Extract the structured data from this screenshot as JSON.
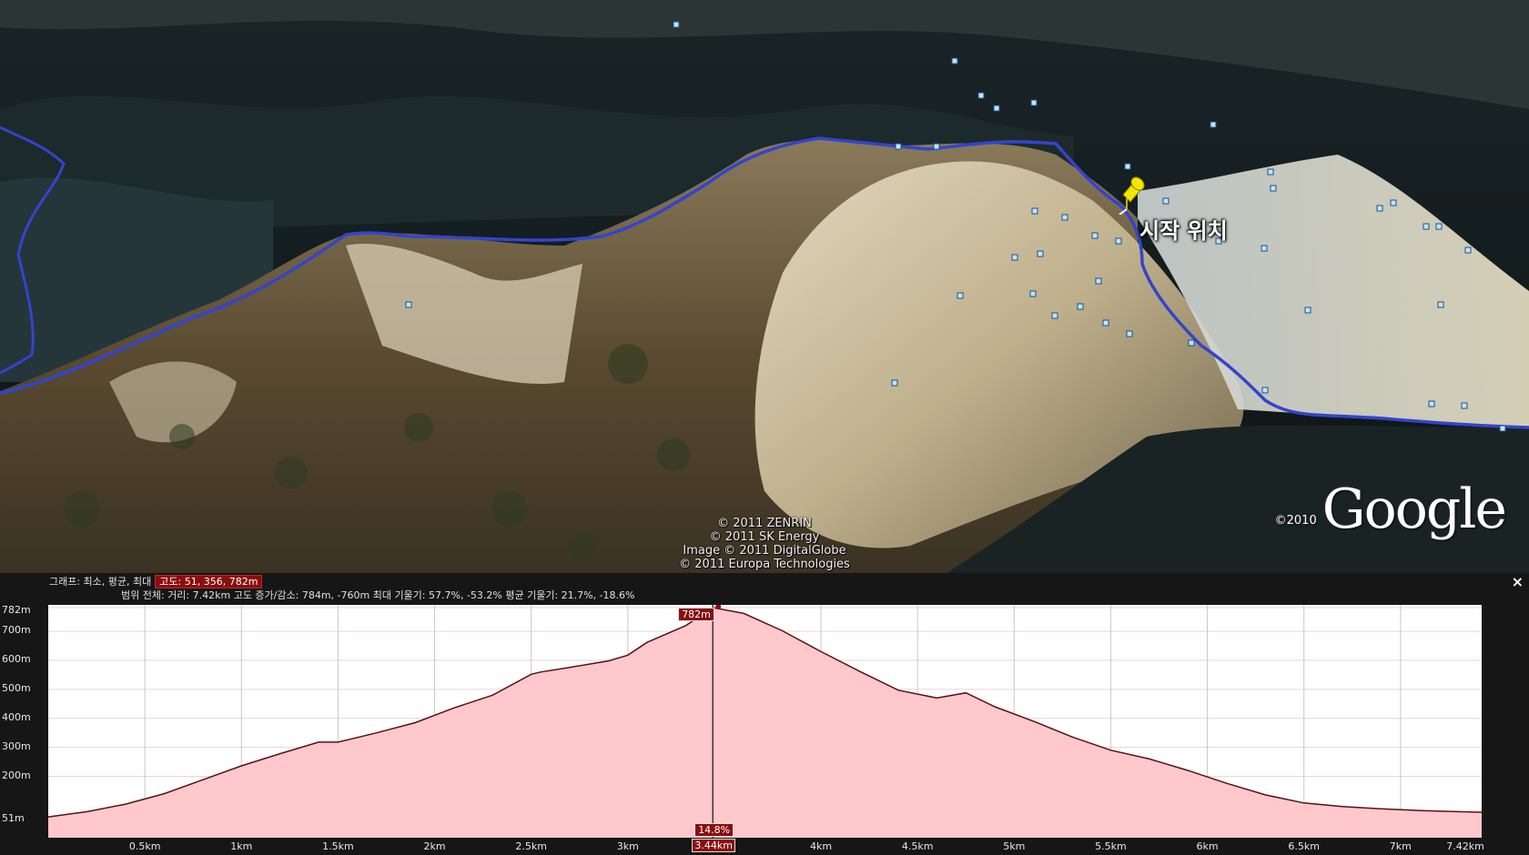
{
  "map": {
    "copyright_lines": [
      "© 2011 ZENRIN",
      "© 2011 SK Energy",
      "Image © 2011 DigitalGlobe",
      "© 2011 Europa Technologies"
    ],
    "google_year": "©2010",
    "google_wordmark": "Google",
    "placemark": {
      "label": "시작 위치",
      "icon": "pushpin-icon",
      "color": "#f5e600"
    },
    "path_color": "#3344cc"
  },
  "profile": {
    "info_prefix": "그래프: 최소, 평균, 최대",
    "altitude_label": "고도: 51, 356, 782m",
    "range_text": "범위 전체: 거리: 7.42km 고도 증가/감소: 784m, -760m 최대 기울기: 57.7%, -53.2% 평균 기울기: 21.7%, -18.6%",
    "close_symbol": "×",
    "cursor_elevation": "782m",
    "cursor_slope": "14.8%",
    "cursor_distance": "3.44km",
    "fill_color": "#ffc8cc",
    "line_color": "#5a1010",
    "marker_color": "#8a0e0e"
  },
  "chart_data": {
    "type": "area",
    "title": "",
    "xlabel": "",
    "ylabel": "",
    "xlim": [
      0,
      7.42
    ],
    "ylim": [
      51,
      782
    ],
    "y_ticks": [
      "782m",
      "700m",
      "600m",
      "500m",
      "400m",
      "300m",
      "200m",
      "51m"
    ],
    "y_tick_values": [
      782,
      700,
      600,
      500,
      400,
      300,
      200,
      51
    ],
    "x_ticks": [
      "0.5km",
      "1km",
      "1.5km",
      "2km",
      "2.5km",
      "3km",
      "3.44km",
      "4km",
      "4.5km",
      "5km",
      "5.5km",
      "6km",
      "6.5km",
      "7km",
      "7.42km"
    ],
    "x_tick_values": [
      0.5,
      1,
      1.5,
      2,
      2.5,
      3,
      3.44,
      4,
      4.5,
      5,
      5.5,
      6,
      6.5,
      7,
      7.42
    ],
    "cursor_x": 3.44,
    "series": [
      {
        "x": [
          0,
          0.2,
          0.4,
          0.6,
          0.8,
          1.0,
          1.2,
          1.4,
          1.5,
          1.7,
          1.9,
          2.1,
          2.3,
          2.5,
          2.55,
          2.7,
          2.9,
          3.0,
          3.1,
          3.3,
          3.44,
          3.6,
          3.8,
          4.0,
          4.2,
          4.4,
          4.6,
          4.75,
          4.9,
          5.1,
          5.3,
          5.5,
          5.7,
          5.9,
          6.1,
          6.3,
          6.5,
          6.7,
          6.9,
          7.1,
          7.3,
          7.42
        ],
        "y": [
          60,
          78,
          104,
          140,
          188,
          236,
          278,
          318,
          318,
          350,
          385,
          436,
          480,
          552,
          560,
          576,
          598,
          618,
          662,
          720,
          782,
          762,
          702,
          630,
          562,
          497,
          470,
          488,
          440,
          390,
          336,
          290,
          260,
          220,
          176,
          136,
          108,
          96,
          88,
          82,
          78,
          76
        ]
      }
    ]
  }
}
